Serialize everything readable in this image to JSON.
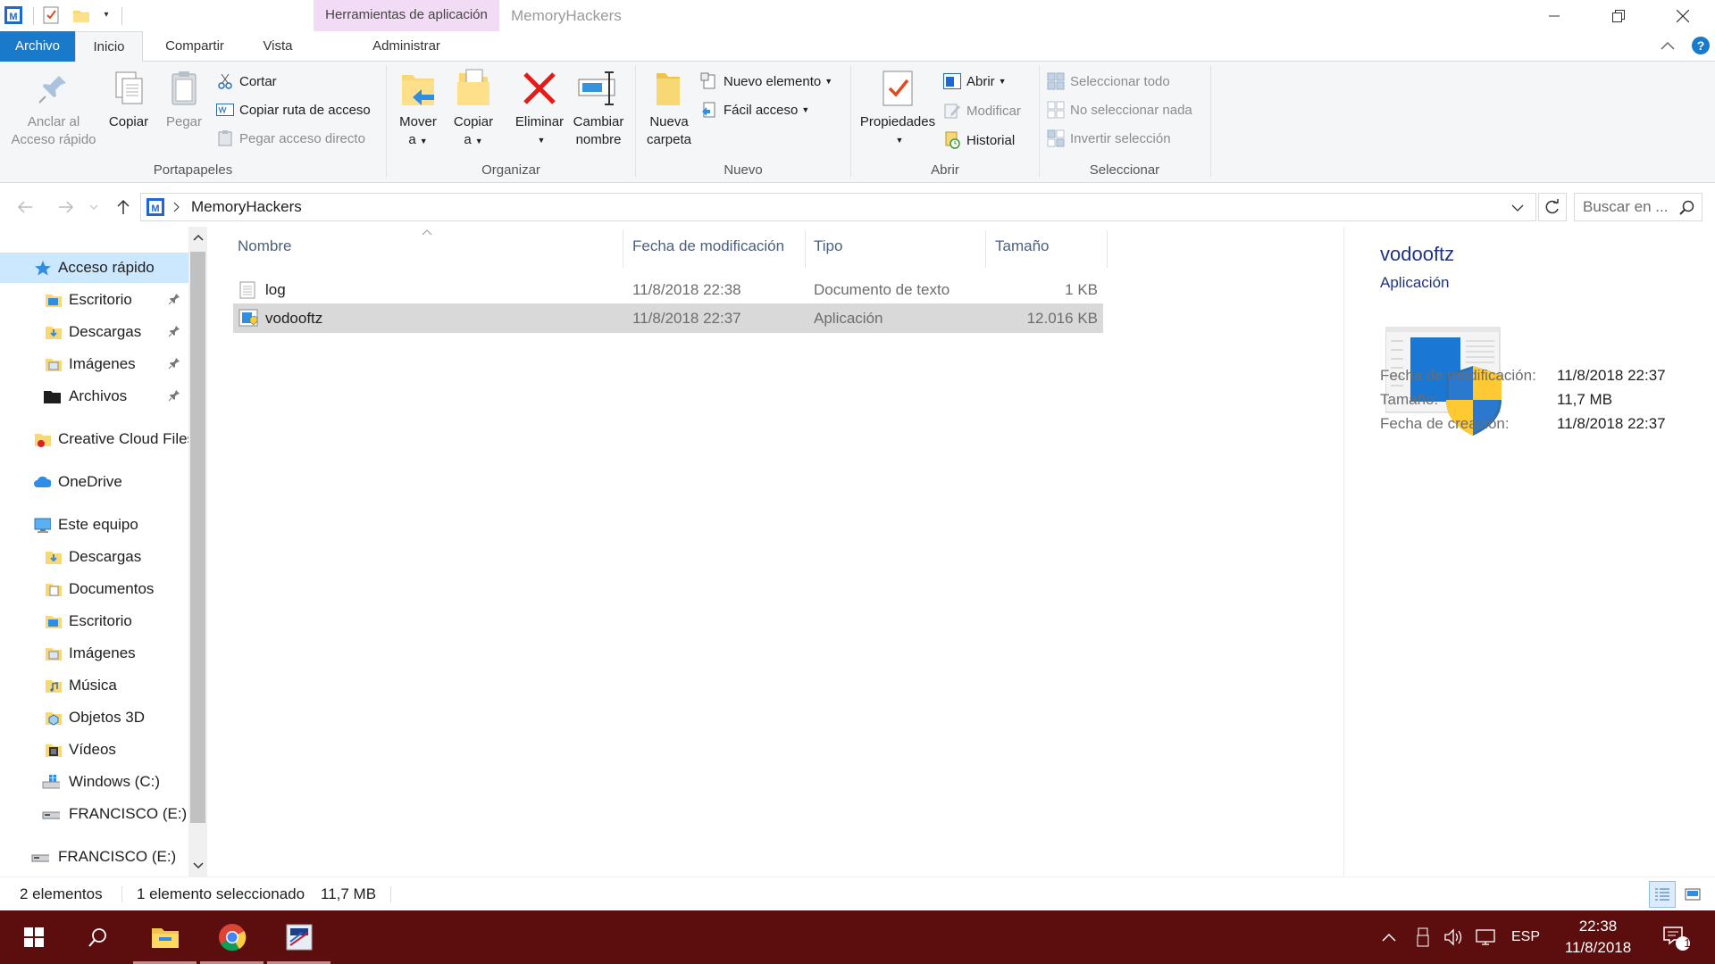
{
  "titlebar": {
    "contextual_tab_label": "Herramientas de aplicación",
    "window_title": "MemoryHackers"
  },
  "tabs": {
    "archivo": "Archivo",
    "inicio": "Inicio",
    "compartir": "Compartir",
    "vista": "Vista",
    "administrar": "Administrar"
  },
  "ribbon": {
    "portapapeles": {
      "group_label": "Portapapeles",
      "pin_line1": "Anclar al",
      "pin_line2": "Acceso rápido",
      "copy": "Copiar",
      "paste": "Pegar",
      "cut": "Cortar",
      "copy_path": "Copiar ruta de acceso",
      "paste_shortcut": "Pegar acceso directo"
    },
    "organizar": {
      "group_label": "Organizar",
      "move_line1": "Mover",
      "move_line2": "a",
      "copy_line1": "Copiar",
      "copy_line2": "a",
      "delete": "Eliminar",
      "rename_line1": "Cambiar",
      "rename_line2": "nombre"
    },
    "nuevo": {
      "group_label": "Nuevo",
      "folder_line1": "Nueva",
      "folder_line2": "carpeta",
      "new_item": "Nuevo elemento",
      "easy_access": "Fácil acceso"
    },
    "abrir": {
      "group_label": "Abrir",
      "properties": "Propiedades",
      "open": "Abrir",
      "edit": "Modificar",
      "history": "Historial"
    },
    "seleccionar": {
      "group_label": "Seleccionar",
      "select_all": "Seleccionar todo",
      "select_none": "No seleccionar nada",
      "invert": "Invertir selección"
    }
  },
  "address": {
    "path": "MemoryHackers",
    "search_placeholder": "Buscar en ..."
  },
  "nav": {
    "items": [
      {
        "label": "Acceso rápido"
      },
      {
        "label": "Escritorio"
      },
      {
        "label": "Descargas"
      },
      {
        "label": "Imágenes"
      },
      {
        "label": "Archivos"
      },
      {
        "label": "Creative Cloud Files"
      },
      {
        "label": "OneDrive"
      },
      {
        "label": "Este equipo"
      },
      {
        "label": "Descargas"
      },
      {
        "label": "Documentos"
      },
      {
        "label": "Escritorio"
      },
      {
        "label": "Imágenes"
      },
      {
        "label": "Música"
      },
      {
        "label": "Objetos 3D"
      },
      {
        "label": "Vídeos"
      },
      {
        "label": "Windows (C:)"
      },
      {
        "label": "FRANCISCO (E:)"
      },
      {
        "label": "FRANCISCO (E:)"
      }
    ]
  },
  "files": {
    "columns": [
      "Nombre",
      "Fecha de modificación",
      "Tipo",
      "Tamaño"
    ],
    "rows": [
      {
        "name": "log",
        "date": "11/8/2018 22:38",
        "type": "Documento de texto",
        "size": "1 KB"
      },
      {
        "name": "vodooftz",
        "date": "11/8/2018 22:37",
        "type": "Aplicación",
        "size": "12.016 KB"
      }
    ]
  },
  "details": {
    "name": "vodooftz",
    "type": "Aplicación",
    "modified_label": "Fecha de modificación:",
    "modified_value": "11/8/2018 22:37",
    "size_label": "Tamaño:",
    "size_value": "11,7 MB",
    "created_label": "Fecha de creación:",
    "created_value": "11/8/2018 22:37"
  },
  "status": {
    "count": "2 elementos",
    "selection": "1 elemento seleccionado",
    "selection_size": "11,7 MB"
  },
  "taskbar": {
    "language": "ESP",
    "time": "22:38",
    "date": "11/8/2018",
    "notification_count": "1"
  },
  "colors": {
    "accent": "#1979ca",
    "taskbar": "#5c0d0d",
    "contextual_tab": "#f2dbf5",
    "selected_row": "#d9d9d9",
    "nav_selected": "#cce8ff"
  }
}
